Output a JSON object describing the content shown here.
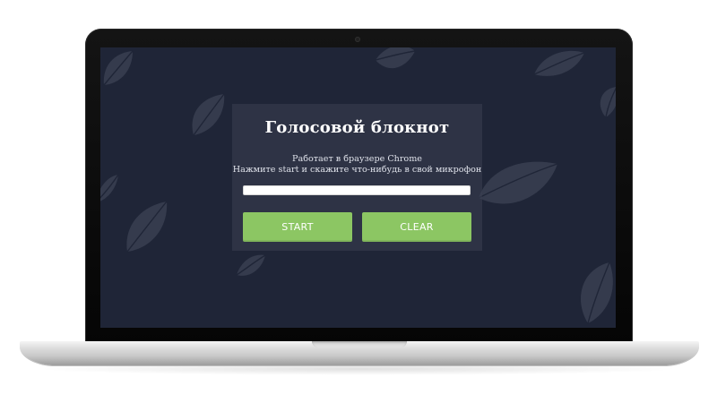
{
  "app": {
    "title": "Голосовой блокнот",
    "subtitle_line1": "Работает в браузере Chrome",
    "subtitle_line2": "Нажмите start и скажите что-нибудь в свой микрофон"
  },
  "input": {
    "value": "",
    "placeholder": ""
  },
  "buttons": {
    "start_label": "START",
    "clear_label": "CLEAR"
  },
  "colors": {
    "screen_background": "#1f2537",
    "card_background": "#3a4052",
    "button_green": "#8cc663",
    "text_white": "#ffffff"
  },
  "icons": {
    "background_decoration": "leaf-icon",
    "device": "laptop-frame"
  }
}
